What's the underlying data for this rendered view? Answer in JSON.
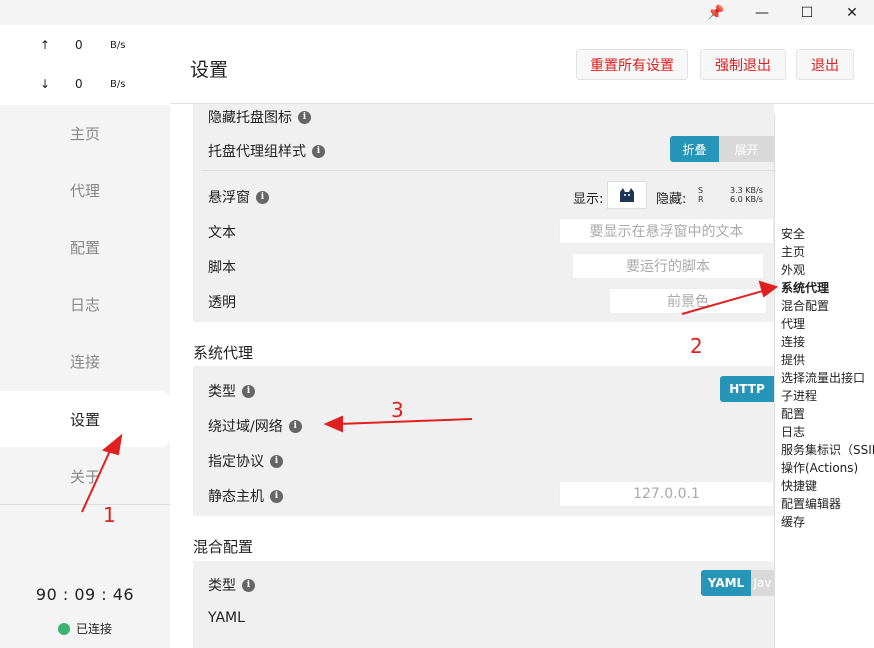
{
  "window_controls": {
    "pin": "📌",
    "minimize": "—",
    "maximize": "☐",
    "close": "✕"
  },
  "speed": {
    "up_arrow": "↑",
    "up_value": "0",
    "up_unit": "B/s",
    "down_arrow": "↓",
    "down_value": "0",
    "down_unit": "B/s"
  },
  "sidebar": {
    "items": [
      {
        "label": "主页"
      },
      {
        "label": "代理"
      },
      {
        "label": "配置"
      },
      {
        "label": "日志"
      },
      {
        "label": "连接"
      },
      {
        "label": "设置"
      },
      {
        "label": "关于"
      }
    ],
    "timer": "90 : 09 : 46",
    "status": "已连接"
  },
  "header": {
    "title": "设置",
    "reset_label": "重置所有设置",
    "force_quit_label": "强制退出",
    "quit_label": "退出"
  },
  "tray": {
    "hide_icon_label": "隐藏托盘图标",
    "proxy_group_style_label": "托盘代理组样式",
    "fold_label": "折叠",
    "expand_label": "展开"
  },
  "float": {
    "label": "悬浮窗",
    "show_label": "显示:",
    "hide_label": "隐藏:",
    "speed_s": "S",
    "speed_r": "R",
    "speed_up": "3.3 KB/s",
    "speed_down": "6.0 KB/s",
    "text_label": "文本",
    "text_placeholder": "要显示在悬浮窗中的文本",
    "script_label": "脚本",
    "script_placeholder": "要运行的脚本",
    "opacity_label": "透明",
    "opacity_placeholder": "前景色"
  },
  "system_proxy": {
    "section_title": "系统代理",
    "type_label": "类型",
    "type_value": "HTTP",
    "bypass_label": "绕过域/网络",
    "protocol_label": "指定协议",
    "static_host_label": "静态主机",
    "static_host_placeholder": "127.0.0.1"
  },
  "mixed_config": {
    "section_title": "混合配置",
    "type_label": "类型",
    "type_on": "YAML",
    "type_off": "Jav",
    "yaml_label": "YAML"
  },
  "toc": {
    "items": [
      {
        "label": "安全"
      },
      {
        "label": "主页"
      },
      {
        "label": "外观"
      },
      {
        "label": "系统代理"
      },
      {
        "label": "混合配置"
      },
      {
        "label": "代理"
      },
      {
        "label": "连接"
      },
      {
        "label": "提供"
      },
      {
        "label": "选择流量出接口"
      },
      {
        "label": "子进程"
      },
      {
        "label": "配置"
      },
      {
        "label": "日志"
      },
      {
        "label": "服务集标识（SSID"
      },
      {
        "label": "操作(Actions)"
      },
      {
        "label": "快捷键"
      },
      {
        "label": "配置编辑器"
      },
      {
        "label": "缓存"
      }
    ]
  },
  "annotations": {
    "a1": "1",
    "a2": "2",
    "a3": "3"
  },
  "colors": {
    "accent": "#2795b8",
    "danger": "#e02020",
    "connected": "#3cb371"
  }
}
